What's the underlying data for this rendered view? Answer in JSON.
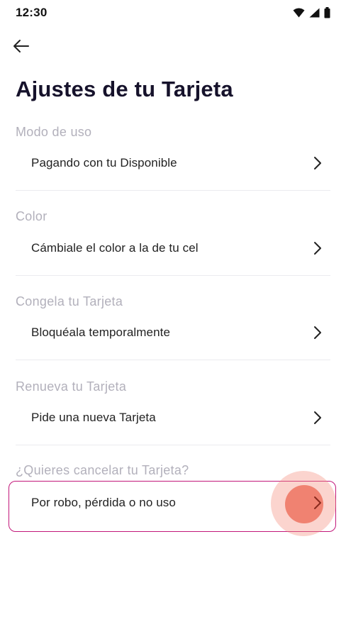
{
  "status_bar": {
    "time": "12:30",
    "icons": [
      "wifi-icon",
      "signal-icon",
      "battery-icon"
    ]
  },
  "nav": {
    "back_icon": "arrow-left-icon"
  },
  "title": "Ajustes de tu Tarjeta",
  "sections": [
    {
      "label": "Modo de uso",
      "option": "Pagando con tu Disponible"
    },
    {
      "label": "Color",
      "option": "Cámbiale el color a la de tu cel"
    },
    {
      "label": "Congela tu Tarjeta",
      "option": "Bloquéala temporalmente"
    },
    {
      "label": "Renueva tu Tarjeta",
      "option": "Pide una nueva Tarjeta"
    },
    {
      "label": "¿Quieres cancelar tu Tarjeta?",
      "option": "Por robo, pérdida o no uso"
    }
  ],
  "colors": {
    "title": "#16122b",
    "section_label": "#b2b0bb",
    "highlight_border": "#c2187a",
    "tap_indicator": "#ec624e"
  }
}
